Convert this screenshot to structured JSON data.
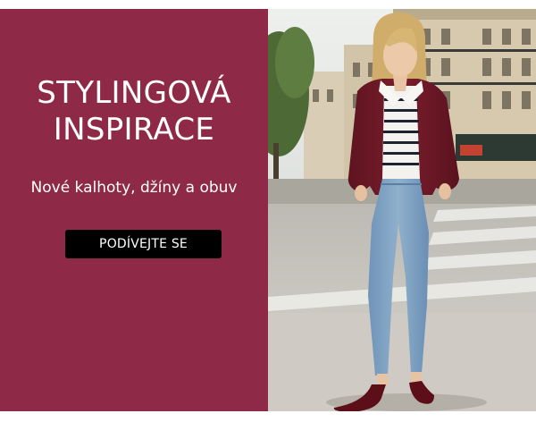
{
  "promo": {
    "headline_line1": "STYLINGOVÁ",
    "headline_line2": "INSPIRACE",
    "subtitle": "Nové kalhoty, džíny a obuv",
    "cta_label": "PODÍVEJTE SE"
  },
  "photo": {
    "alt": "Žena v bordó bundě, pruhovaném tričku a džínách na pařížské ulici"
  },
  "colors": {
    "panel_background": "#8e2a48",
    "cta_background": "#000000",
    "text": "#ffffff"
  }
}
